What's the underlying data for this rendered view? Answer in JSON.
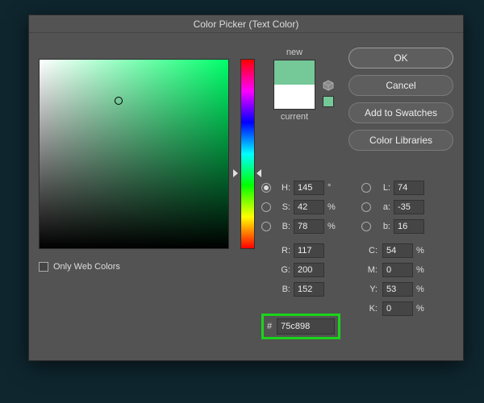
{
  "title": "Color Picker (Text Color)",
  "buttons": {
    "ok": "OK",
    "cancel": "Cancel",
    "add": "Add to Swatches",
    "libraries": "Color Libraries"
  },
  "swatch": {
    "new_label": "new",
    "current_label": "current",
    "new_color": "#75c898",
    "current_color": "#ffffff"
  },
  "picker": {
    "hue_deg": 145,
    "sat_pct": 42,
    "bri_pct": 78,
    "hue_slider_pct": 60
  },
  "hsb": {
    "h": {
      "label": "H:",
      "value": "145",
      "unit": "°"
    },
    "s": {
      "label": "S:",
      "value": "42",
      "unit": "%"
    },
    "b": {
      "label": "B:",
      "value": "78",
      "unit": "%"
    }
  },
  "rgb": {
    "r": {
      "label": "R:",
      "value": "117"
    },
    "g": {
      "label": "G:",
      "value": "200"
    },
    "b": {
      "label": "B:",
      "value": "152"
    }
  },
  "lab": {
    "l": {
      "label": "L:",
      "value": "74"
    },
    "a": {
      "label": "a:",
      "value": "-35"
    },
    "b": {
      "label": "b:",
      "value": "16"
    }
  },
  "cmyk": {
    "c": {
      "label": "C:",
      "value": "54",
      "unit": "%"
    },
    "m": {
      "label": "M:",
      "value": "0",
      "unit": "%"
    },
    "y": {
      "label": "Y:",
      "value": "53",
      "unit": "%"
    },
    "k": {
      "label": "K:",
      "value": "0",
      "unit": "%"
    }
  },
  "hex": {
    "hash": "#",
    "value": "75c898"
  },
  "web_colors": {
    "label": "Only Web Colors",
    "checked": false
  },
  "selected_radio": "H"
}
